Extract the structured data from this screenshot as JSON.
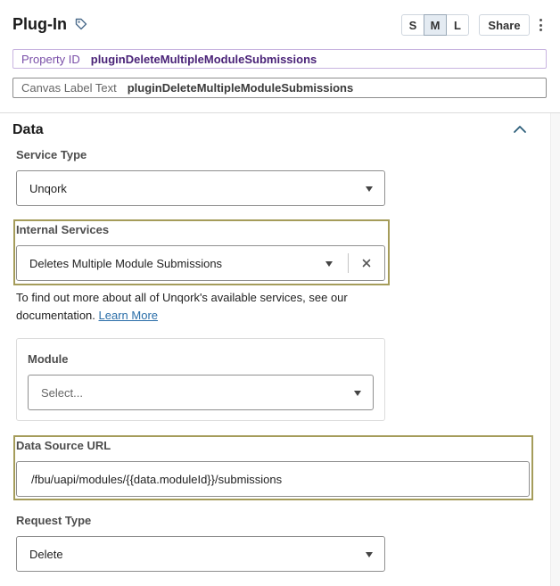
{
  "header": {
    "title": "Plug-In",
    "sizes": [
      "S",
      "M",
      "L"
    ],
    "active_size": "M",
    "share_label": "Share"
  },
  "property_id": {
    "label": "Property ID",
    "value": "pluginDeleteMultipleModuleSubmissions"
  },
  "canvas_label": {
    "label": "Canvas Label Text",
    "value": "pluginDeleteMultipleModuleSubmissions"
  },
  "section": {
    "title": "Data"
  },
  "service_type": {
    "label": "Service Type",
    "value": "Unqork"
  },
  "internal_services": {
    "label": "Internal Services",
    "value": "Deletes Multiple Module Submissions"
  },
  "help": {
    "text": "To find out more about all of Unqork's available services, see our documentation.",
    "link_text": "Learn More"
  },
  "module": {
    "label": "Module",
    "placeholder": "Select..."
  },
  "data_source_url": {
    "label": "Data Source URL",
    "value": "/fbu/uapi/modules/{{data.moduleId}}/submissions"
  },
  "request_type": {
    "label": "Request Type",
    "value": "Delete"
  },
  "colors": {
    "highlight_border": "#a59c5a",
    "property_border": "#c8b4e0",
    "property_text": "#4a2378",
    "link": "#2a6ea8"
  },
  "icons": [
    "tag-icon",
    "kebab-menu-icon",
    "chevron-up-icon",
    "caret-down-icon",
    "close-icon"
  ]
}
